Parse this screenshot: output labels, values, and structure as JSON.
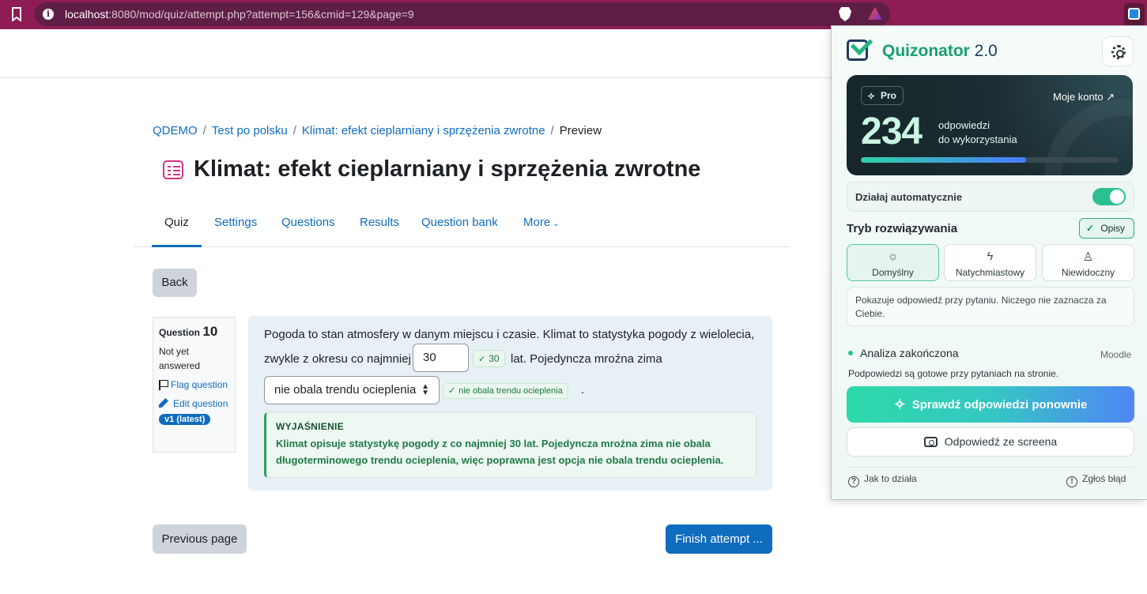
{
  "browser": {
    "url_host": "localhost",
    "url_rest": ":8080/mod/quiz/attempt.php?attempt=156&cmid=129&page=9"
  },
  "breadcrumb": {
    "items": [
      "QDEMO",
      "Test po polsku",
      "Klimat: efekt cieplarniany i sprzężenia zwrotne"
    ],
    "current": "Preview",
    "separator": "/"
  },
  "page": {
    "title": "Klimat: efekt cieplarniany i sprzężenia zwrotne",
    "title_icon": "quiz-icon"
  },
  "tabs": {
    "items": [
      "Quiz",
      "Settings",
      "Questions",
      "Results",
      "Question bank",
      "More"
    ],
    "active": "Quiz",
    "more_caret": "⌄"
  },
  "buttons": {
    "back": "Back",
    "previous_page": "Previous page",
    "finish_attempt": "Finish attempt ..."
  },
  "question_info": {
    "label": "Question",
    "number": "10",
    "state": "Not yet answered",
    "flag": "Flag question",
    "edit": "Edit question",
    "version": "v1 (latest)"
  },
  "question": {
    "text_line1": "Pogoda to stan atmosfery w danym miejscu i czasie. Klimat to statystyka pogody z wielolecia,",
    "text_line2": "zwykle z okresu co najmniej",
    "input_value": "30",
    "hint1": "30",
    "text_line3": "lat. Pojedyncza mroźna zima",
    "select_value": "nie obala trendu ocieplenia",
    "hint2": "nie obala trendu ocieplenia",
    "end": ".",
    "hint_check": "✓",
    "explanation_label": "WYJAŚNIENIE",
    "explanation_text": "Klimat opisuje statystykę pogody z co najmniej 30 lat. Pojedyncza mroźna zima nie obala długoterminowego trendu ocieplenia, więc poprawna jest opcja nie obala trendu ocieplenia."
  },
  "extension": {
    "brand": "Quizonator",
    "version": "2.0",
    "pro": "Pro",
    "account": "Moje konto ↗",
    "answers_count": "234",
    "answers_label_1": "odpowiedzi",
    "answers_label_2": "do wykorzystania",
    "answers_progress_pct": 64,
    "auto_label": "Działaj automatycznie",
    "auto_on": true,
    "mode_title": "Tryb rozwiązywania",
    "opisy": "Opisy",
    "modes": [
      {
        "label": "Domyślny",
        "icon": "sun-icon",
        "glyph": "☼",
        "selected": true
      },
      {
        "label": "Natychmiastowy",
        "icon": "bolt-icon",
        "glyph": "ϟ",
        "selected": false
      },
      {
        "label": "Niewidoczny",
        "icon": "ghost-icon",
        "glyph": "♙",
        "selected": false
      }
    ],
    "mode_desc": "Pokazuje odpowiedź przy pytaniu. Niczego nie zaznacza za Ciebie.",
    "status": "Analiza zakończona",
    "status_source": "Moodle",
    "status_sub": "Podpowiedzi są gotowe przy pytaniach na stronie.",
    "check_again": "Sprawdź odpowiedzi ponownie",
    "screen_answer": "Odpowiedź ze screena",
    "help": "Jak to działa",
    "report": "Zgłoś błąd",
    "colors": {
      "accent": "#2bbf92",
      "brand": "#18a06f",
      "navy": "#1e3a5f"
    }
  }
}
